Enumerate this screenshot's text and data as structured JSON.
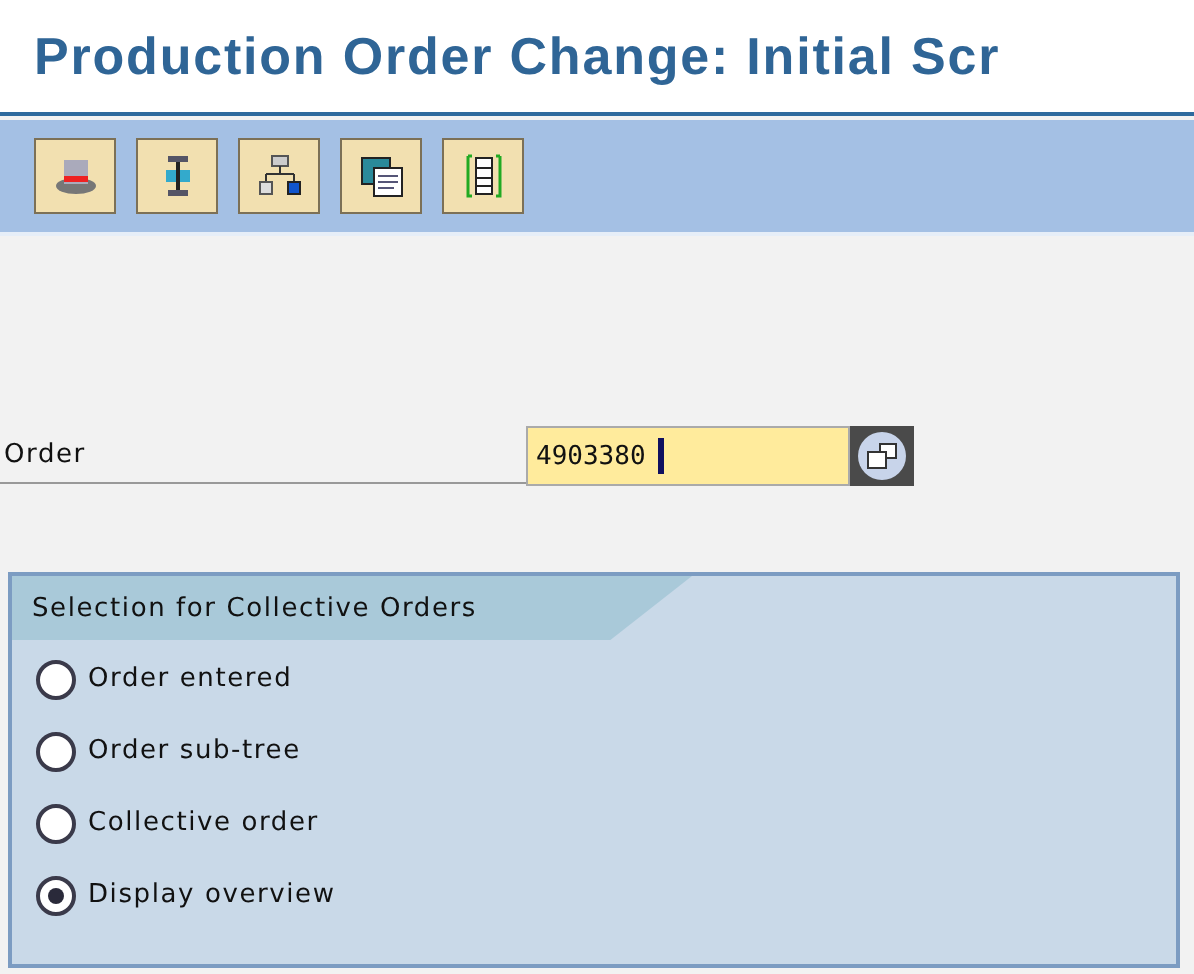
{
  "window": {
    "title": "Production Order Change: Initial Scr"
  },
  "toolbar": {
    "buttons": [
      {
        "kind": "hat"
      },
      {
        "kind": "flow"
      },
      {
        "kind": "tree"
      },
      {
        "kind": "copy"
      },
      {
        "kind": "stack"
      }
    ]
  },
  "order_field": {
    "label": "Order",
    "value": "4903380"
  },
  "collective_orders": {
    "title": "Selection for Collective Orders",
    "options": [
      {
        "label": "Order entered",
        "selected": false
      },
      {
        "label": "Order sub-tree",
        "selected": false
      },
      {
        "label": "Collective order",
        "selected": false
      },
      {
        "label": "Display overview",
        "selected": true
      }
    ]
  }
}
